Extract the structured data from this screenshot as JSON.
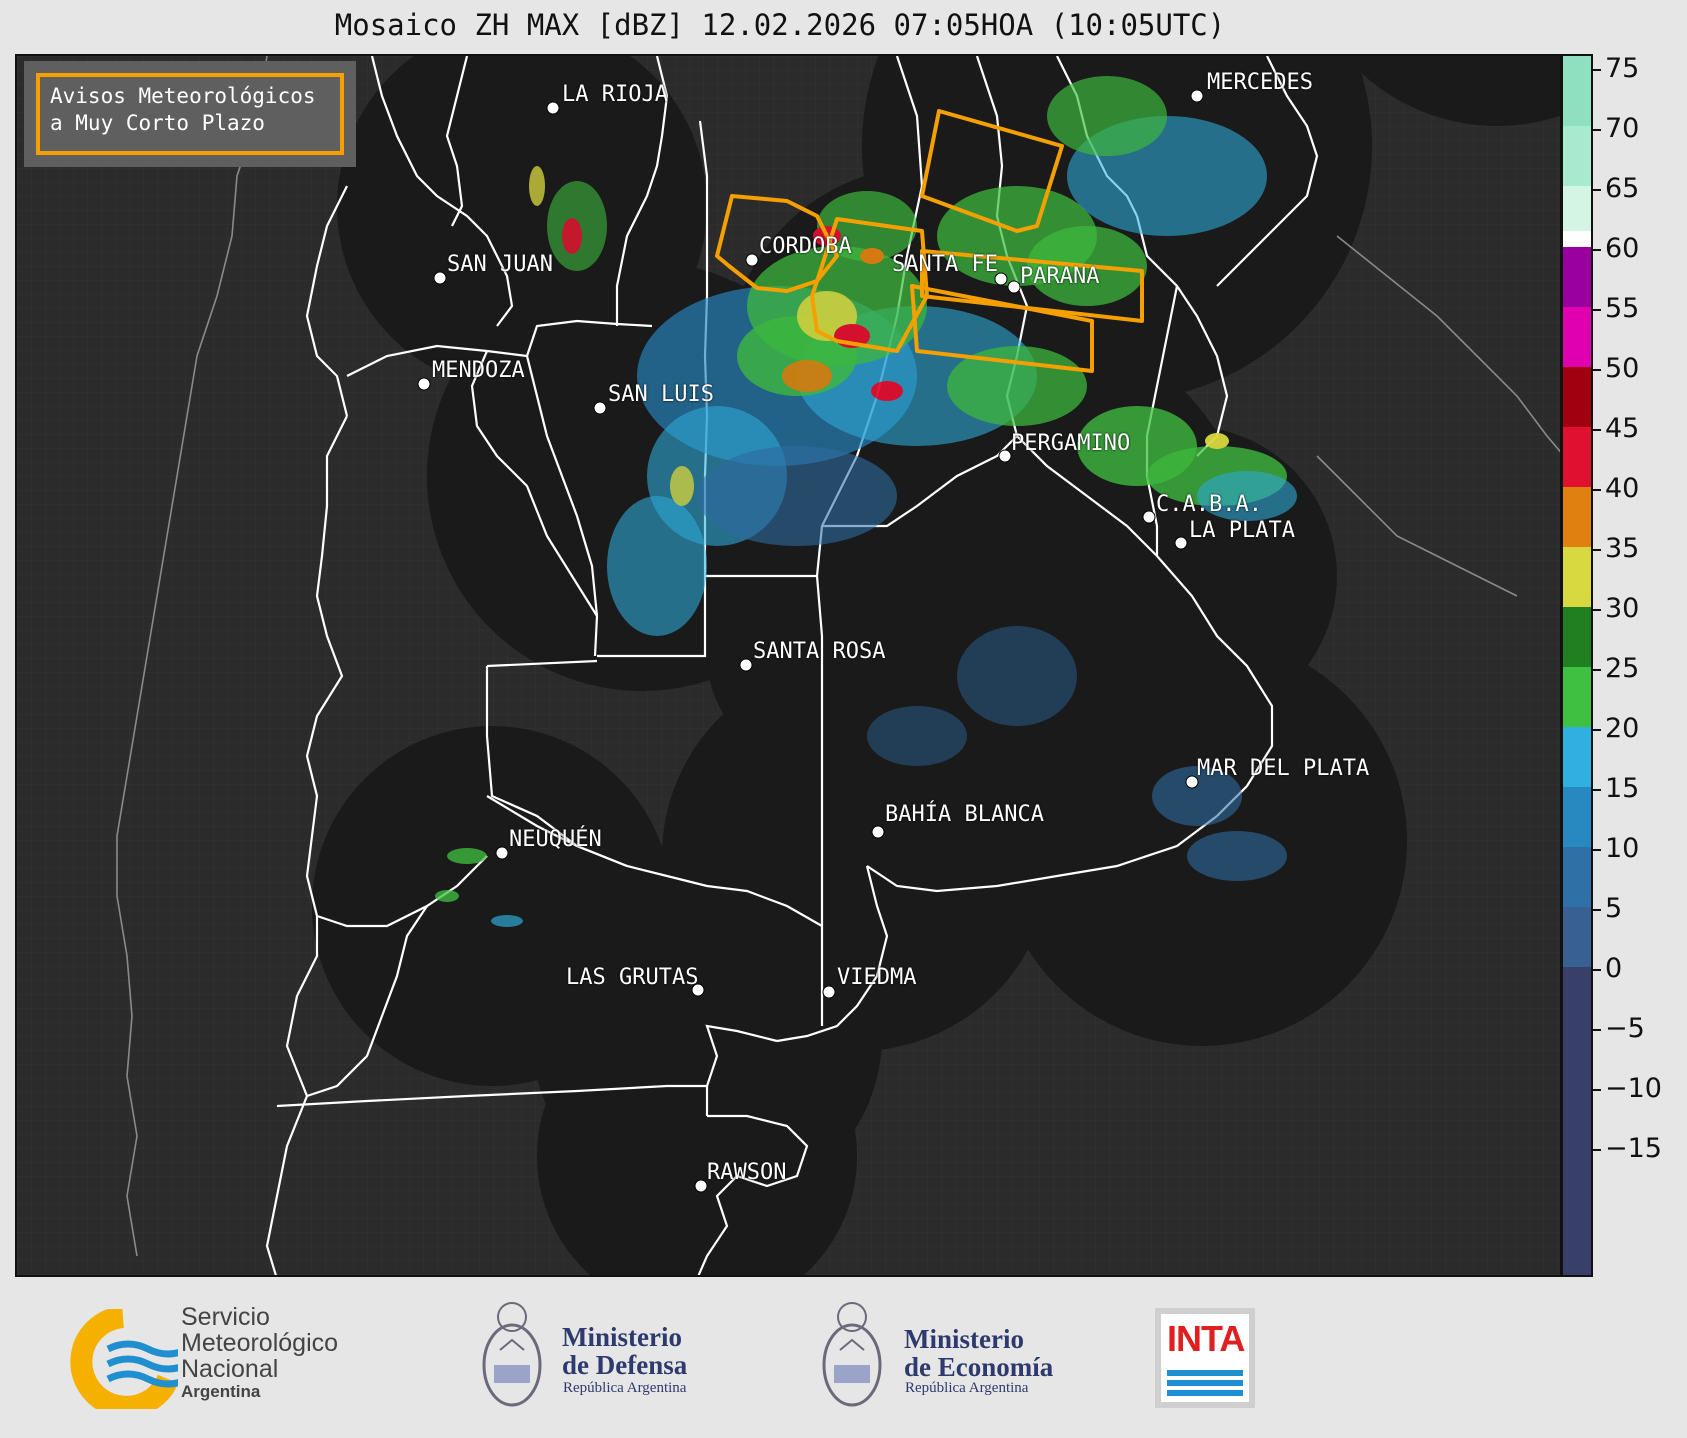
{
  "title": "Mosaico ZH MAX [dBZ] 12.02.2026 07:05HOA (10:05UTC)",
  "notice": {
    "line1": "Avisos Meteorológicos",
    "line2": "a Muy Corto Plazo",
    "border_color": "#f5a000"
  },
  "cities": [
    {
      "name": "LA RIOJA"
    },
    {
      "name": "MERCEDES"
    },
    {
      "name": "CORDOBA"
    },
    {
      "name": "SAN JUAN"
    },
    {
      "name": "SANTA FE"
    },
    {
      "name": "PARANA"
    },
    {
      "name": "MENDOZA"
    },
    {
      "name": "SAN LUIS"
    },
    {
      "name": "PERGAMINO"
    },
    {
      "name": "C.A.B.A."
    },
    {
      "name": "LA PLATA"
    },
    {
      "name": "SANTA ROSA"
    },
    {
      "name": "MAR DEL PLATA"
    },
    {
      "name": "BAHÍA BLANCA"
    },
    {
      "name": "NEUQUÉN"
    },
    {
      "name": "LAS GRUTAS"
    },
    {
      "name": "VIEDMA"
    },
    {
      "name": "RAWSON"
    }
  ],
  "colorbar": {
    "ticks": [
      "75",
      "70",
      "65",
      "60",
      "55",
      "50",
      "45",
      "40",
      "35",
      "30",
      "25",
      "20",
      "15",
      "10",
      "5",
      "0",
      "−5",
      "−10",
      "−15"
    ],
    "colors": {
      "above_70": "#8fe0c0",
      "65_70": "#a8ead0",
      "60_65": "#d4f4e4",
      "60": "#ffffff",
      "55_60": "#9a00a0",
      "50_55": "#e000b0",
      "45_50": "#a00010",
      "40_45": "#e01030",
      "35_40": "#e08010",
      "30_35": "#d8d840",
      "25_30": "#208020",
      "20_25": "#40c040",
      "15_20": "#30b0e0",
      "10_15": "#2888c0",
      "5_10": "#3070a8",
      "0_5": "#386090",
      "neg": "#38406a"
    }
  },
  "footer": {
    "smn": {
      "line1": "Servicio",
      "line2": "Meteorológico",
      "line3": "Nacional",
      "line4": "Argentina"
    },
    "defensa": {
      "title1": "Ministerio",
      "title2": "de Defensa",
      "sub": "República Argentina"
    },
    "economia": {
      "title1": "Ministerio",
      "title2": "de Economía",
      "sub": "República Argentina"
    },
    "inta": {
      "text": "INTA"
    }
  },
  "colors": {
    "background_land": "#2a2a2a",
    "radar_coverage": "#1a1a1a",
    "warning_polygon": "#f5a000"
  }
}
